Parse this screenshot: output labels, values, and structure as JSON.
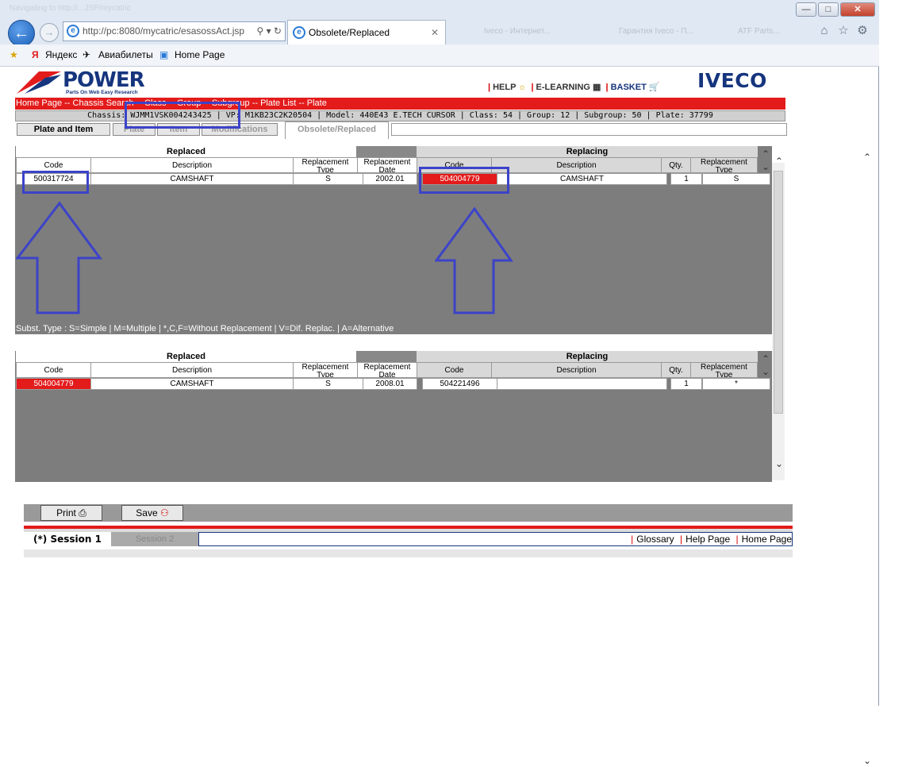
{
  "browser": {
    "title_faded": "Navigating to http://...JSP/mycatric",
    "address": "http://pc:8080/mycatric/esasossAct.jsp",
    "address_host": "pc",
    "tab_title": "Obsolete/Replaced",
    "ghost_tabs": [
      "Iveco - Интернет...",
      "Гарантия Iveco - П...",
      "ATF Parts..."
    ],
    "favorites": [
      "Яндекс",
      "Авиабилеты",
      "Home Page"
    ]
  },
  "app": {
    "logo_text": "POWER",
    "logo_tagline": "Parts On Web Easy Research",
    "brand": "IVECO",
    "top_links": [
      "HELP",
      "E-LEARNING",
      "BASKET"
    ],
    "breadcrumb": "Home Page -- Chassis Search -- Class -- Group -- Subgroup -- Plate List -- Plate",
    "info": "Chassis: WJMM1VSK004243425 | VP: M1KB23C2K20504 | Model: 440E43 E.TECH CURSOR | Class: 54 | Group: 12 | Subgroup: 50 | Plate: 37799",
    "tabs": [
      "Plate and Item",
      "Plate",
      "Item",
      "Modifications",
      "Obsolete/Replaced"
    ]
  },
  "tables": [
    {
      "replaced_label": "Replaced",
      "replacing_label": "Replacing",
      "headers": [
        "Code",
        "Description",
        "Replacement Type",
        "Replacement Date",
        "Code",
        "Description",
        "Qty.",
        "Replacement Type"
      ],
      "row": [
        "500317724",
        "CAMSHAFT",
        "S",
        "2002.01",
        "504004779",
        "CAMSHAFT",
        "1",
        "S"
      ]
    },
    {
      "replaced_label": "Replaced",
      "replacing_label": "Replacing",
      "headers": [
        "Code",
        "Description",
        "Replacement Type",
        "Replacement Date",
        "Code",
        "Description",
        "Qty.",
        "Replacement Type"
      ],
      "row": [
        "504004779",
        "CAMSHAFT",
        "S",
        "2008.01",
        "504221496",
        "",
        "1",
        "*"
      ]
    }
  ],
  "legend": "Subst. Type : S=Simple | M=Multiple | *,C,F=Without Replacement | V=Dif. Replac. | A=Alternative",
  "toolbar": {
    "print": "Print",
    "save": "Save"
  },
  "sessions": [
    "(*) Session 1",
    "Session 2"
  ],
  "footer_links": [
    "Glossary",
    "Help Page",
    "Home Page"
  ],
  "colors": {
    "accent_red": "#e31b1b",
    "brand_blue": "#16357e",
    "annotation_blue": "#3c43c8"
  }
}
